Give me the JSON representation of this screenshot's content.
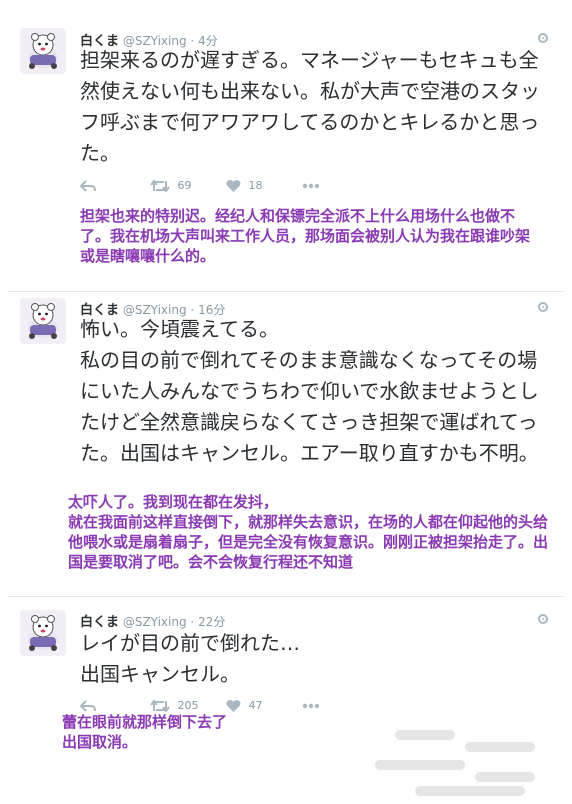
{
  "tweets": [
    {
      "name": "白くま",
      "handle": "@SZYixing",
      "sep": "·",
      "time": "4分",
      "text": "担架来るのが遅すぎる。マネージャーもセキュも全然使えない何も出来ない。私が大声で空港のスタッフ呼ぶまで何アワアワしてるのかとキレるかと思った。",
      "retweets": "69",
      "likes": "18",
      "translation": "担架也来的特别迟。经纪人和保镖完全派不上什么用场什么也做不了。我在机场大声叫来工作人员，那场面会被别人认为我在跟谁吵架或是瞎嚷嚷什么的。"
    },
    {
      "name": "白くま",
      "handle": "@SZYixing",
      "sep": "·",
      "time": "16分",
      "text": "怖い。今頃震えてる。\n私の目の前で倒れてそのまま意識なくなってその場にいた人みんなでうちわで仰いで水飲ませようとしたけど全然意識戻らなくてさっき担架で運ばれてった。出国はキャンセル。エアー取り直すかも不明。",
      "translation": "太吓人了。我到现在都在发抖，\n就在我面前这样直接倒下，就那样失去意识，在场的人都在仰起他的头给他喂水或是扇着扇子，但是完全没有恢复意识。刚刚正被担架抬走了。出国是要取消了吧。会不会恢复行程还不知道"
    },
    {
      "name": "白くま",
      "handle": "@SZYixing",
      "sep": "·",
      "time": "22分",
      "text": "レイが目の前で倒れた…\n出国キャンセル。",
      "retweets": "205",
      "likes": "47",
      "translation": "蕾在眼前就那样倒下去了\n出国取消。"
    }
  ],
  "icons": {
    "avatar": "cartoon-bear-avatar-icon",
    "menu": "gear-icon",
    "reply": "reply-icon",
    "retweet": "retweet-icon",
    "like": "heart-icon",
    "more": "more-dots-icon"
  },
  "colors": {
    "translation_text": "#8a3bb3",
    "action_icons": "#aab8c2",
    "meta_text": "#8899a6",
    "tweet_text": "#292f33"
  }
}
